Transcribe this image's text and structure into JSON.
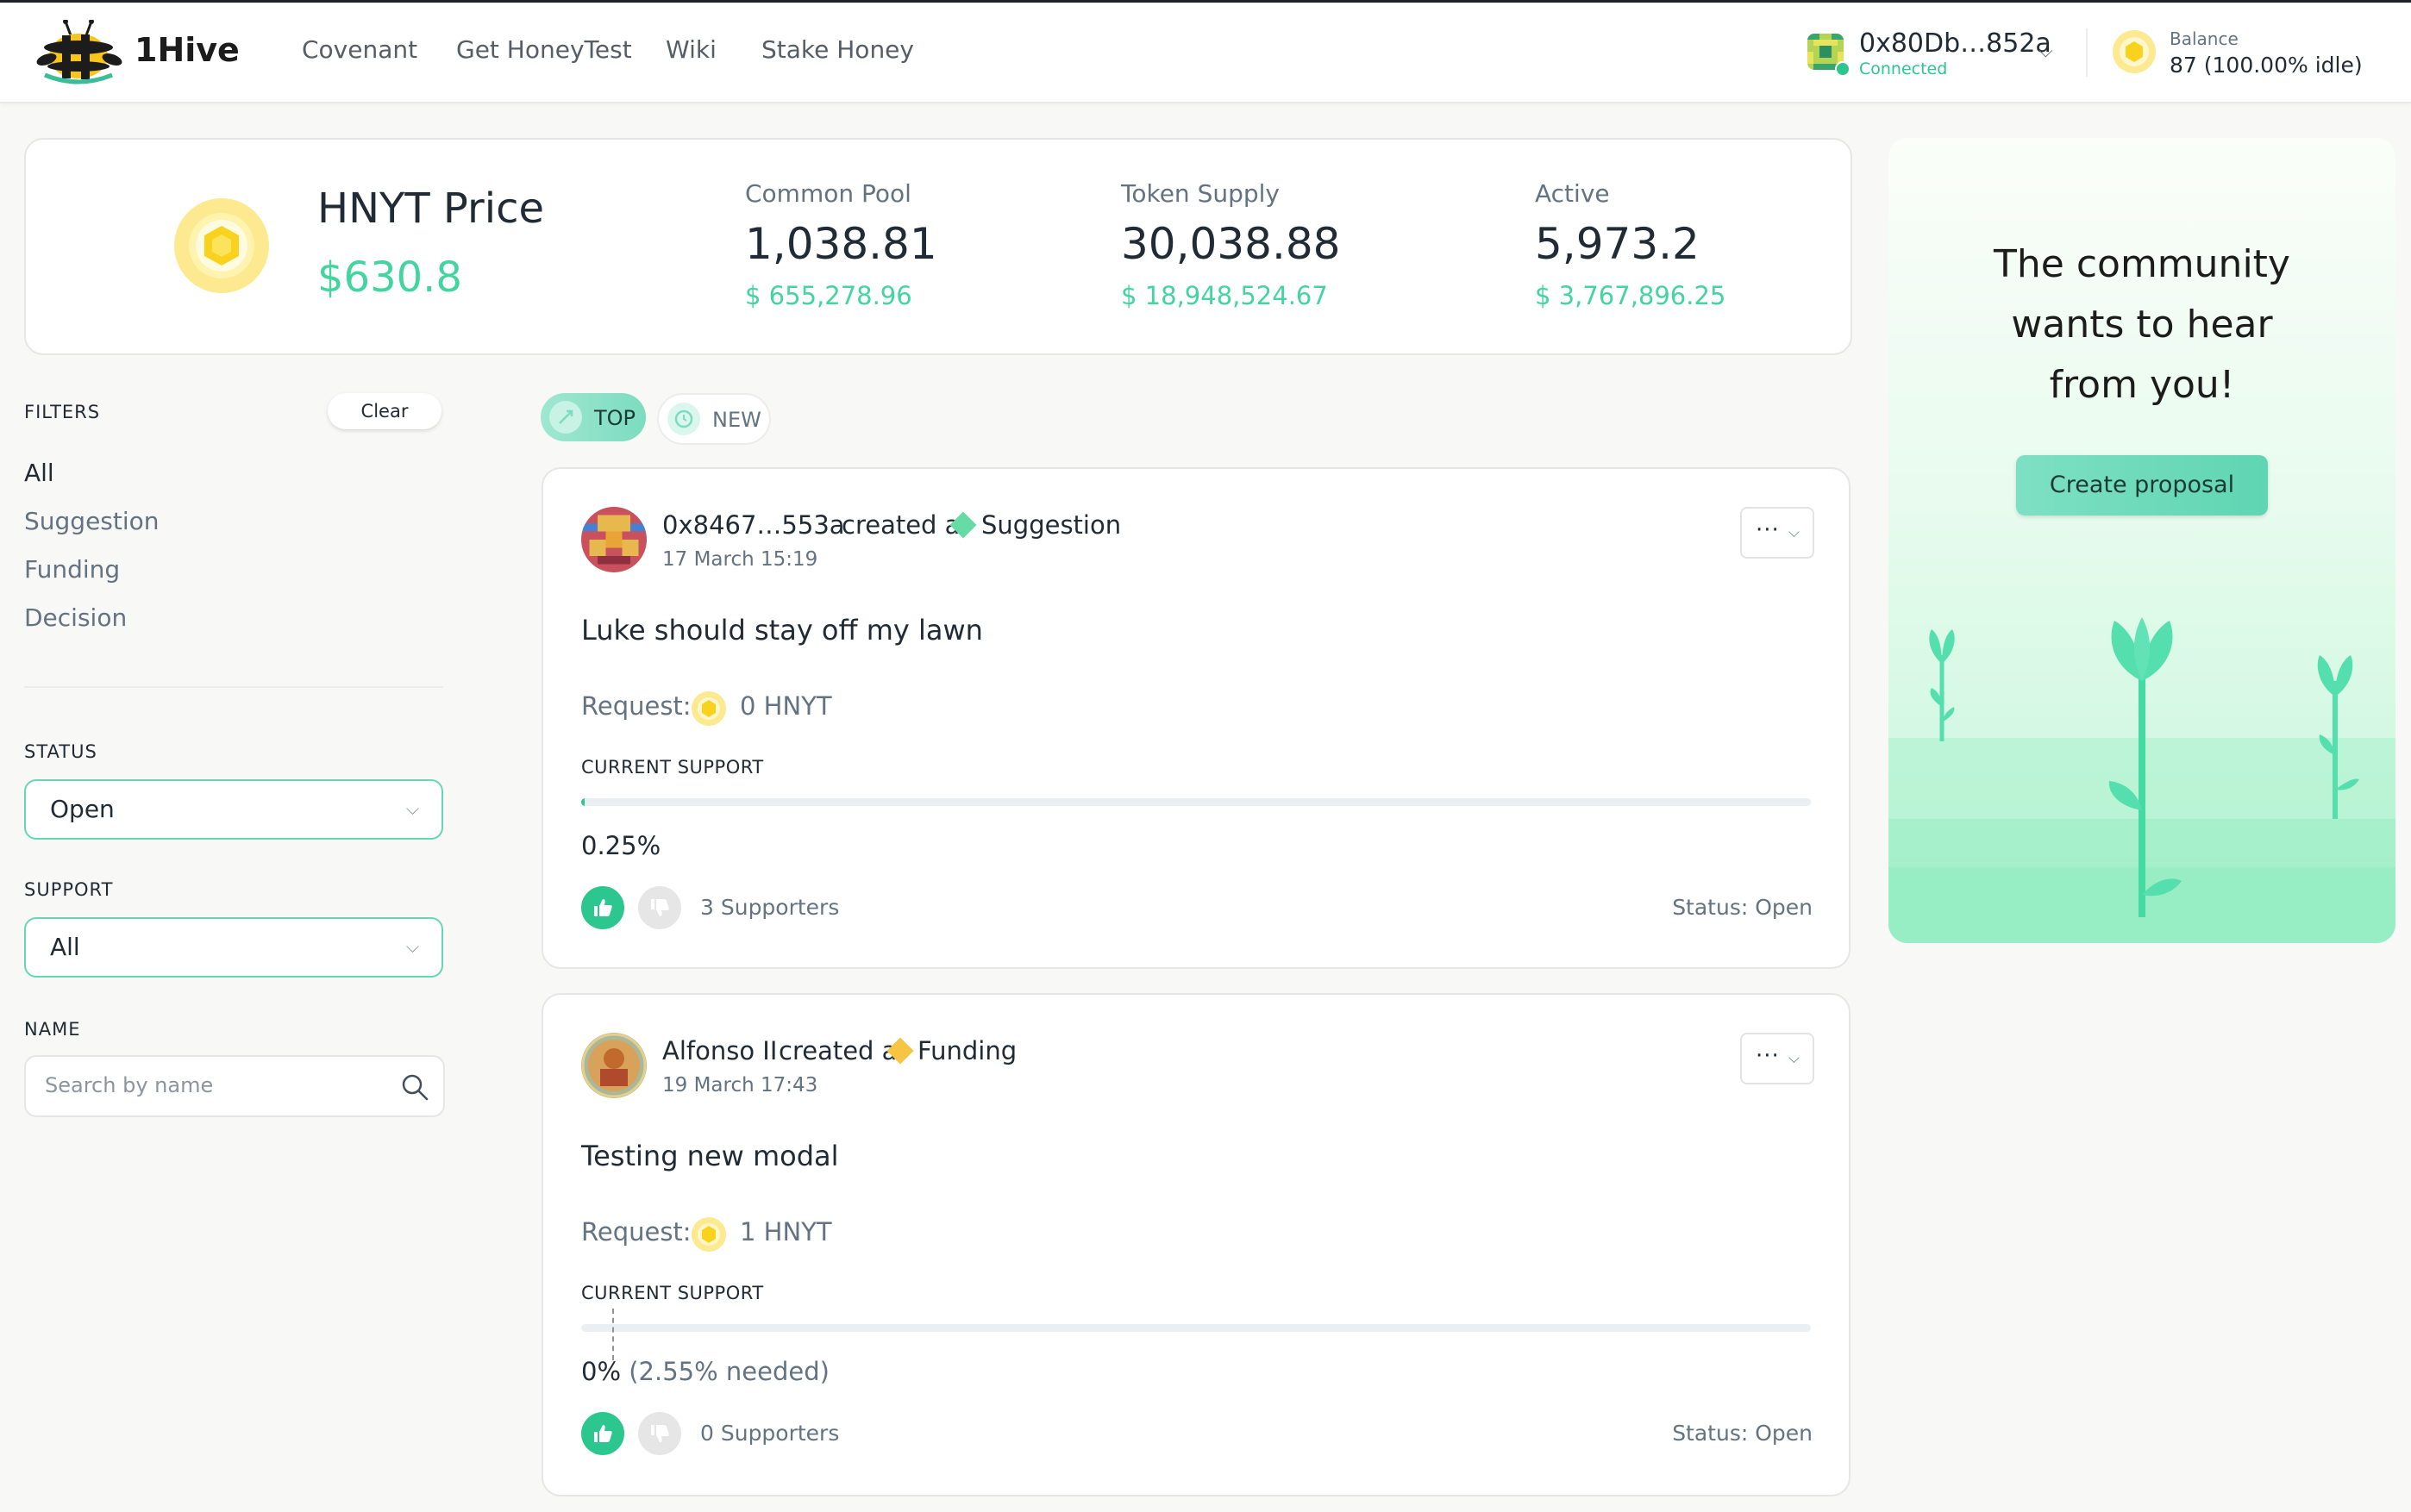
{
  "header": {
    "brand": "1Hive",
    "nav": [
      "Covenant",
      "Get HoneyTest",
      "Wiki",
      "Stake Honey"
    ],
    "account": {
      "address": "0x80Db…852a",
      "status": "Connected"
    },
    "balance": {
      "label": "Balance",
      "value": "87 (100.00% idle)"
    }
  },
  "metrics": {
    "price_title": "HNYT Price",
    "price_value": "$630.8",
    "common_pool": {
      "label": "Common Pool",
      "value": "1,038.81",
      "usd": "$ 655,278.96"
    },
    "token_supply": {
      "label": "Token Supply",
      "value": "30,038.88",
      "usd": "$ 18,948,524.67"
    },
    "active": {
      "label": "Active",
      "value": "5,973.2",
      "usd": "$ 3,767,896.25"
    }
  },
  "filters": {
    "heading": "FILTERS",
    "clear_label": "Clear",
    "types": [
      "All",
      "Suggestion",
      "Funding",
      "Decision"
    ],
    "selected_type": "All",
    "status_label": "STATUS",
    "status_value": "Open",
    "support_label": "SUPPORT",
    "support_value": "All",
    "name_label": "NAME",
    "name_placeholder": "Search by name"
  },
  "tabs": {
    "top": "TOP",
    "new": "NEW",
    "active": "TOP"
  },
  "proposals": [
    {
      "author": "0x8467…553a",
      "created_text": "created a",
      "kind": "Suggestion",
      "kind_color": "#67dba5",
      "date": "17 March 15:19",
      "title": "Luke should stay off my lawn",
      "request_label": "Request:",
      "request_value": "0 HNYT",
      "support_label": "CURRENT SUPPORT",
      "support_fraction": 0.0025,
      "support_text": "0.25%",
      "needed_text": "",
      "needed_fraction": null,
      "supporters": "3 Supporters",
      "status": "Status: Open"
    },
    {
      "author": "Alfonso II",
      "created_text": "created a",
      "kind": "Funding",
      "kind_color": "#f6c544",
      "date": "19 March 17:43",
      "title": "Testing new modal",
      "request_label": "Request:",
      "request_value": "1 HNYT",
      "support_label": "CURRENT SUPPORT",
      "support_fraction": 0,
      "support_text": "0%",
      "needed_text": "(2.55% needed)",
      "needed_fraction": 0.0255,
      "supporters": "0 Supporters",
      "status": "Status: Open"
    }
  ],
  "sidebar_cta": {
    "heading_lines": [
      "The community",
      "wants to hear",
      "from you!"
    ],
    "button_label": "Create proposal"
  },
  "colors": {
    "accent": "#2cc68f",
    "price": "#44d4a0",
    "button": "#67d6b4"
  }
}
